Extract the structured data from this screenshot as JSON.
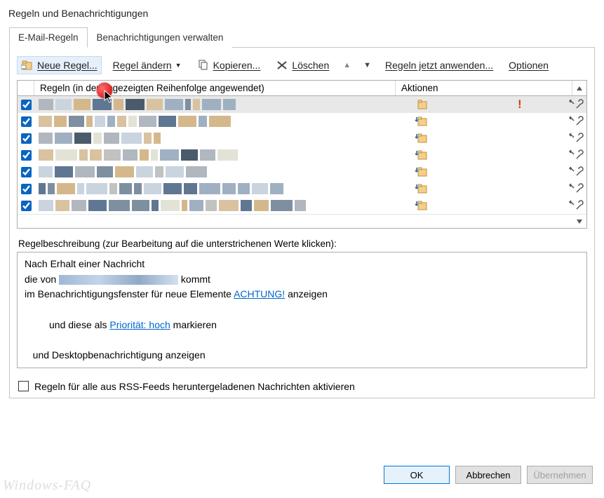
{
  "window": {
    "title": "Regeln und Benachrichtigungen"
  },
  "tabs": [
    {
      "label": "E-Mail-Regeln",
      "active": true
    },
    {
      "label": "Benachrichtigungen verwalten",
      "active": false
    }
  ],
  "toolbar": {
    "new_rule": "Neue Regel...",
    "change_rule": "Regel ändern",
    "copy": "Kopieren...",
    "delete": "Löschen",
    "apply_now": "Regeln jetzt anwenden...",
    "options": "Optionen"
  },
  "grid": {
    "header_rules": "Regeln (in der angezeigten Reihenfolge angewendet)",
    "header_actions": "Aktionen",
    "rows": [
      {
        "checked": true,
        "selected": true,
        "action_icon": "alert-folder",
        "exclaim": true
      },
      {
        "checked": true,
        "action_icon": "move-folder"
      },
      {
        "checked": true,
        "action_icon": "move-folder"
      },
      {
        "checked": true,
        "action_icon": "move-folder"
      },
      {
        "checked": true,
        "action_icon": "move-folder"
      },
      {
        "checked": true,
        "action_icon": "move-folder"
      },
      {
        "checked": true,
        "action_icon": "move-folder"
      }
    ]
  },
  "description": {
    "label": "Regelbeschreibung (zur Bearbeitung auf die unterstrichenen Werte klicken):",
    "line1": "Nach Erhalt einer Nachricht",
    "line2_prefix": "die von ",
    "line2_suffix": " kommt",
    "line3_prefix": "im Benachrichtigungsfenster für neue Elemente ",
    "line3_link": "ACHTUNG!",
    "line3_suffix": " anzeigen",
    "line4_prefix": "   und diese als ",
    "line4_link": "Priorität: hoch",
    "line4_suffix": " markieren",
    "line5": "   und Desktopbenachrichtigung anzeigen"
  },
  "rss_checkbox": {
    "checked": false,
    "label": "Regeln für alle aus RSS-Feeds heruntergeladenen Nachrichten aktivieren"
  },
  "buttons": {
    "ok": "OK",
    "cancel": "Abbrechen",
    "apply": "Übernehmen"
  },
  "watermark": "Windows-FAQ"
}
